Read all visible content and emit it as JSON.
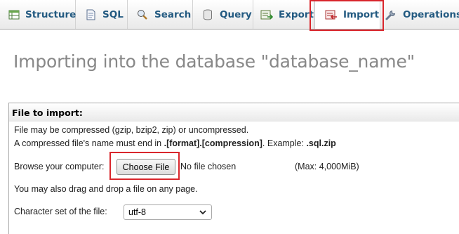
{
  "tabs": [
    {
      "label": "Structure",
      "icon": "structure-icon",
      "active": false
    },
    {
      "label": "SQL",
      "icon": "sql-icon",
      "active": false
    },
    {
      "label": "Search",
      "icon": "search-icon",
      "active": false
    },
    {
      "label": "Query",
      "icon": "query-icon",
      "active": false
    },
    {
      "label": "Export",
      "icon": "export-icon",
      "active": false
    },
    {
      "label": "Import",
      "icon": "import-icon",
      "active": true
    },
    {
      "label": "Operations",
      "icon": "operations-icon",
      "active": false
    }
  ],
  "page": {
    "title": "Importing into the database \"database_name\""
  },
  "file_section": {
    "header": "File to import:",
    "line1": "File may be compressed (gzip, bzip2, zip) or uncompressed.",
    "line2_prefix": "A compressed file's name must end in ",
    "line2_bold": ".[format].[compression]",
    "line2_mid": ". Example: ",
    "line2_example": ".sql.zip",
    "browse_label": "Browse your computer:",
    "choose_button": "Choose File",
    "no_file": "No file chosen",
    "max_size": "(Max: 4,000MiB)",
    "drag_hint": "You may also drag and drop a file on any page.",
    "charset_label": "Character set of the file:",
    "charset_value": "utf-8"
  },
  "colors": {
    "tab_text": "#235a81",
    "highlight": "#d9262c",
    "title": "#888888"
  }
}
